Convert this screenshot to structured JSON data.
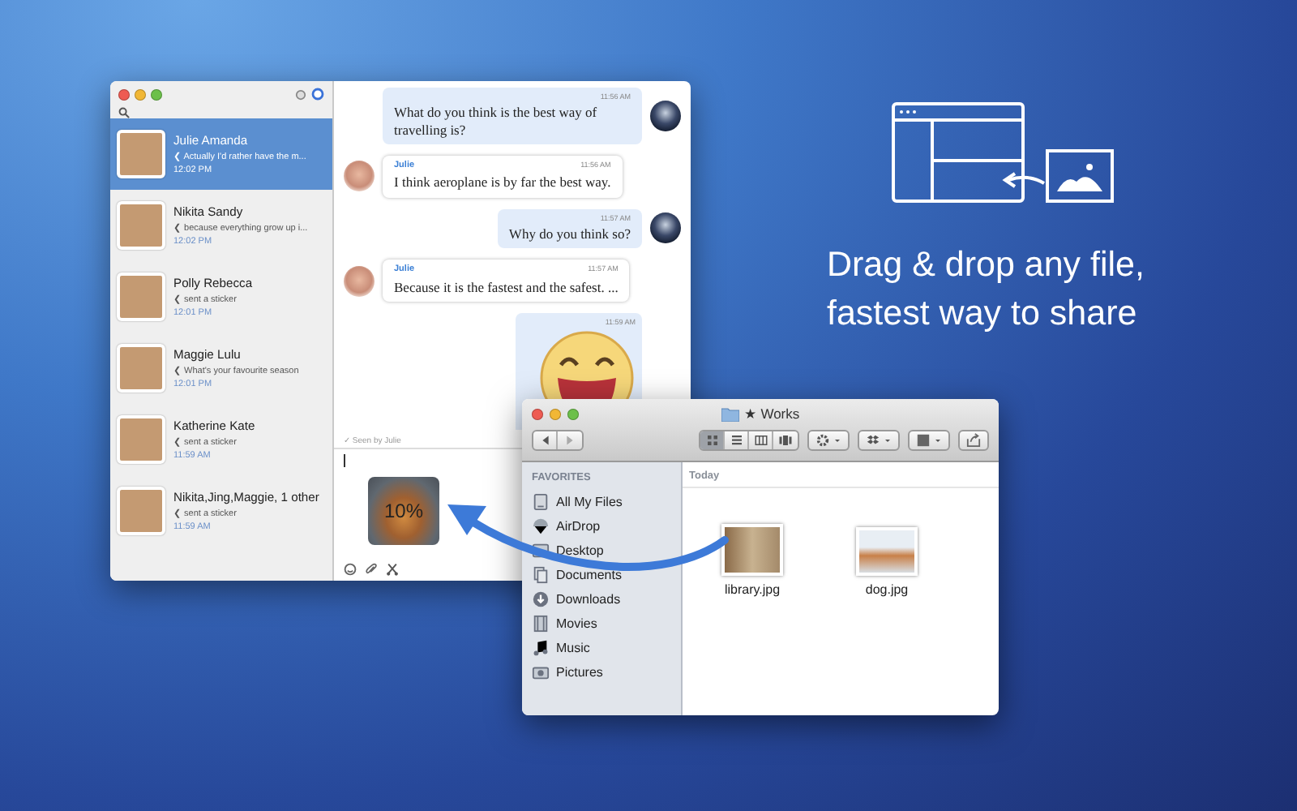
{
  "chat_window": {
    "conversations": [
      {
        "name": "Julie Amanda",
        "preview": "❮ Actually I'd rather have the m...",
        "time": "12:02 PM",
        "selected": true
      },
      {
        "name": "Nikita Sandy",
        "preview": "❮ because everything grow up i...",
        "time": "12:02 PM",
        "selected": false
      },
      {
        "name": "Polly  Rebecca",
        "preview": "❮ sent a sticker",
        "time": "12:01 PM",
        "selected": false
      },
      {
        "name": "Maggie Lulu",
        "preview": "❮ What's your favourite season",
        "time": "12:01 PM",
        "selected": false
      },
      {
        "name": "Katherine Kate",
        "preview": "❮ sent a sticker",
        "time": "11:59 AM",
        "selected": false
      },
      {
        "name": "Nikita,Jing,Maggie, 1 other",
        "preview": "❮ sent a sticker",
        "time": "11:59 AM",
        "selected": false
      }
    ],
    "messages": [
      {
        "kind": "outgoing",
        "time": "11:56 AM",
        "text": "What do you think is the best way of travelling is?"
      },
      {
        "kind": "incoming",
        "sender": "Julie",
        "time": "11:56 AM",
        "text": "I think aeroplane is by far the best way."
      },
      {
        "kind": "outgoing",
        "time": "11:57 AM",
        "text": "Why do you think so?"
      },
      {
        "kind": "incoming",
        "sender": "Julie",
        "time": "11:57 AM",
        "text": "Because it is the fastest and the safest. ..."
      },
      {
        "kind": "sticker",
        "time": "11:59 AM"
      }
    ],
    "seen_note": "✓ Seen by Julie",
    "attachment": {
      "progress": "10%"
    }
  },
  "finder_window": {
    "title": "★ Works",
    "view_modes": [
      {
        "kind": "icons",
        "selected": true
      },
      {
        "kind": "list",
        "selected": false
      },
      {
        "kind": "columns",
        "selected": false
      },
      {
        "kind": "coverflow",
        "selected": false
      }
    ],
    "sidebar_header": "FAVORITES",
    "sidebar_items": [
      {
        "kind": "files",
        "label": "All My Files"
      },
      {
        "kind": "airdrop",
        "label": "AirDrop"
      },
      {
        "kind": "desktop",
        "label": "Desktop"
      },
      {
        "kind": "documents",
        "label": "Documents"
      },
      {
        "kind": "downloads",
        "label": "Downloads"
      },
      {
        "kind": "movies",
        "label": "Movies"
      },
      {
        "kind": "music",
        "label": "Music"
      },
      {
        "kind": "pictures",
        "label": "Pictures"
      }
    ],
    "section": "Today",
    "files": [
      {
        "name": "library.jpg"
      },
      {
        "name": "dog.jpg"
      }
    ]
  },
  "promo": {
    "lines": [
      "Drag & drop any file,",
      "fastest way to share"
    ]
  }
}
